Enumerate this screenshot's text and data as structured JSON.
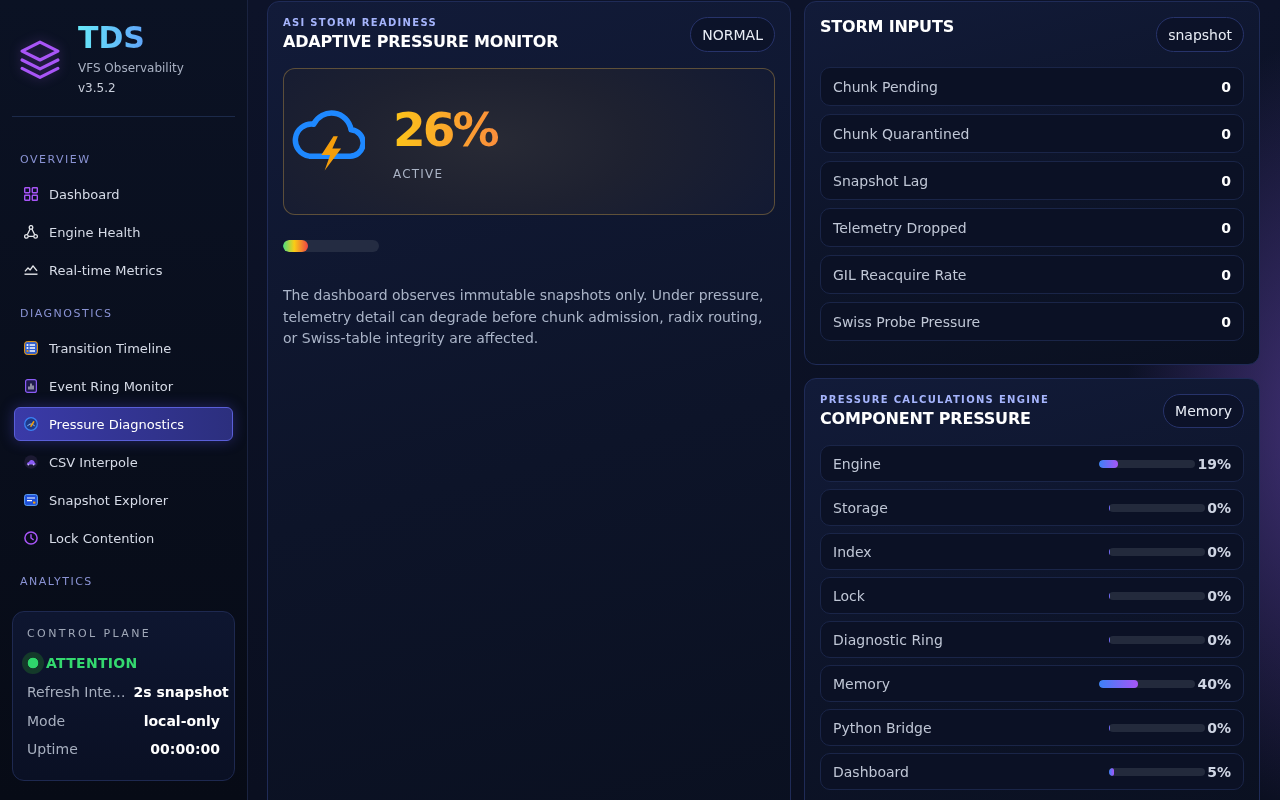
{
  "sidebar": {
    "brand": {
      "name": "TDS",
      "subtitle": "VFS Observability",
      "version": "v3.5.2"
    },
    "sections": [
      {
        "heading": "OVERVIEW",
        "items": [
          {
            "label": "Dashboard",
            "selected": false
          },
          {
            "label": "Engine Health",
            "selected": false
          },
          {
            "label": "Real-time Metrics",
            "selected": false
          }
        ]
      },
      {
        "heading": "DIAGNOSTICS",
        "items": [
          {
            "label": "Transition Timeline",
            "selected": false
          },
          {
            "label": "Event Ring Monitor",
            "selected": false
          },
          {
            "label": "Pressure Diagnostics",
            "selected": true
          },
          {
            "label": "CSV Interpole",
            "selected": false
          },
          {
            "label": "Snapshot Explorer",
            "selected": false
          },
          {
            "label": "Lock Contention",
            "selected": false
          }
        ]
      },
      {
        "heading": "ANALYTICS"
      }
    ],
    "control_plane": {
      "heading": "CONTROL PLANE",
      "status": "ATTENTION",
      "rows": [
        {
          "label": "Refresh Inte…",
          "value": "2s snapshot"
        },
        {
          "label": "Mode",
          "value": "local-only"
        },
        {
          "label": "Uptime",
          "value": "00:00:00"
        }
      ]
    }
  },
  "pressure_monitor": {
    "eyebrow": "ASI STORM READINESS",
    "title": "ADAPTIVE PRESSURE MONITOR",
    "badge": "NORMAL",
    "gauge": {
      "value": "26%",
      "state": "ACTIVE",
      "level": 0.26
    },
    "note": "The dashboard observes immutable snapshots only. Under pressure, telemetry detail can degrade before chunk admission, radix routing, or Swiss-table integrity are affected."
  },
  "storm_inputs": {
    "title": "STORM INPUTS",
    "badge": "snapshot",
    "rows": [
      {
        "label": "Chunk Pending",
        "value": "0"
      },
      {
        "label": "Chunk Quarantined",
        "value": "0"
      },
      {
        "label": "Snapshot Lag",
        "value": "0"
      },
      {
        "label": "Telemetry Dropped",
        "value": "0"
      },
      {
        "label": "GIL Reacquire Rate",
        "value": "0"
      },
      {
        "label": "Swiss Probe Pressure",
        "value": "0"
      }
    ]
  },
  "component_pressure": {
    "eyebrow": "PRESSURE CALCULATIONS ENGINE",
    "title": "COMPONENT PRESSURE",
    "badge": "Memory",
    "rows": [
      {
        "label": "Engine",
        "level": 0.19,
        "reading": "19%"
      },
      {
        "label": "Storage",
        "level": 0,
        "reading": "0%"
      },
      {
        "label": "Index",
        "level": 0,
        "reading": "0%"
      },
      {
        "label": "Lock",
        "level": 0,
        "reading": "0%"
      },
      {
        "label": "Diagnostic Ring",
        "level": 0,
        "reading": "0%"
      },
      {
        "label": "Memory",
        "level": 0.4,
        "reading": "40%"
      },
      {
        "label": "Python Bridge",
        "level": 0,
        "reading": "0%"
      },
      {
        "label": "Dashboard",
        "level": 0.05,
        "reading": "5%"
      }
    ]
  }
}
